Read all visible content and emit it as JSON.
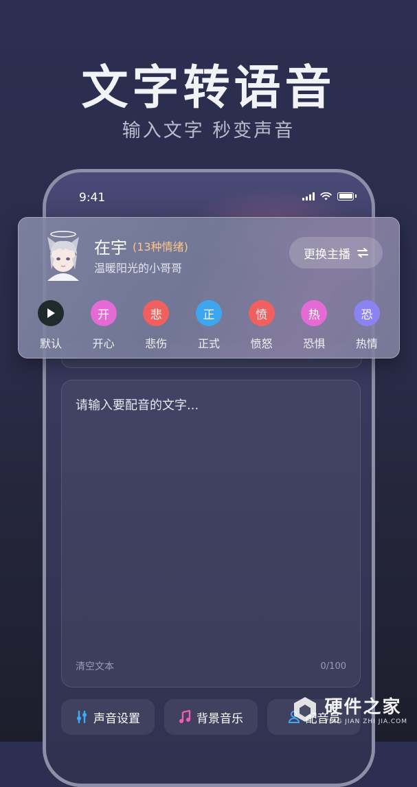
{
  "hero": {
    "title": "文字转语音",
    "subtitle": "输入文字  秒变声音"
  },
  "status_bar": {
    "time": "9:41"
  },
  "anchor": {
    "name": "在宇",
    "emotion_count": "(13种情绪)",
    "description": "温暖阳光的小哥哥",
    "switch_label": "更换主播",
    "switch_icon": "swap-arrows-icon"
  },
  "emotions": [
    {
      "char": "",
      "label": "默认",
      "color": "#1f2a2a",
      "icon": "play-icon"
    },
    {
      "char": "开",
      "label": "开心",
      "color": "#e46bd5"
    },
    {
      "char": "悲",
      "label": "悲伤",
      "color": "#f0605f"
    },
    {
      "char": "正",
      "label": "正式",
      "color": "#3ea6f0"
    },
    {
      "char": "愤",
      "label": "愤怒",
      "color": "#f0605f"
    },
    {
      "char": "热",
      "label": "恐惧",
      "color": "#e46bd5"
    },
    {
      "char": "恐",
      "label": "热情",
      "color": "#8b83f2"
    }
  ],
  "editor": {
    "placeholder": "请输入要配音的文字...",
    "clear_label": "清空文本",
    "count": "0/100"
  },
  "bottom_bar": {
    "voice_settings": "声音设置",
    "bg_music": "背景音乐",
    "dubber": "配音员"
  },
  "watermark": {
    "title": "硬件之家",
    "subtitle": "YING JIAN ZHI JIA.COM"
  }
}
